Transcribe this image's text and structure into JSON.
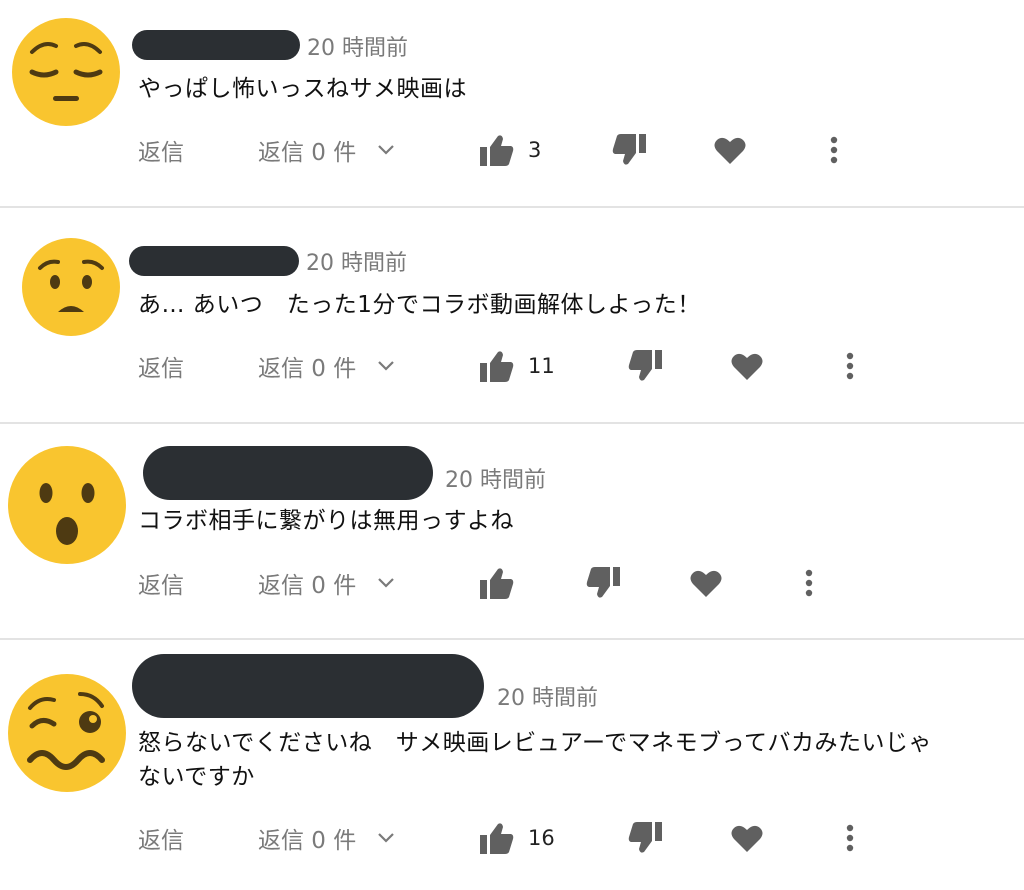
{
  "colors": {
    "avatar": "#f9c52f",
    "face": "#4e3a12",
    "redaction": "#2b2f33",
    "icon": "#606060",
    "muted": "#7a7a7a"
  },
  "comments": [
    {
      "avatar_icon": "pensive-face-icon",
      "time": "20 時間前",
      "text_lines": [
        "やっぱし怖いっスねサメ映画は"
      ],
      "reply_label": "返信",
      "replies_label": "返信 0 件",
      "like_count": "3"
    },
    {
      "avatar_icon": "worried-face-icon",
      "time": "20 時間前",
      "text_lines": [
        "あ… あいつ　たった1分でコラボ動画解体しよった！"
      ],
      "reply_label": "返信",
      "replies_label": "返信 0 件",
      "like_count": "11"
    },
    {
      "avatar_icon": "hushed-face-icon",
      "time": "20 時間前",
      "text_lines": [
        "コラボ相手に繋がりは無用っすよね"
      ],
      "reply_label": "返信",
      "replies_label": "返信 0 件",
      "like_count": ""
    },
    {
      "avatar_icon": "woozy-face-icon",
      "time": "20 時間前",
      "text_lines": [
        "怒らないでくださいね　サメ映画レビュアーでマネモブってバカみたいじゃ",
        "ないですか"
      ],
      "reply_label": "返信",
      "replies_label": "返信 0 件",
      "like_count": "16"
    }
  ]
}
